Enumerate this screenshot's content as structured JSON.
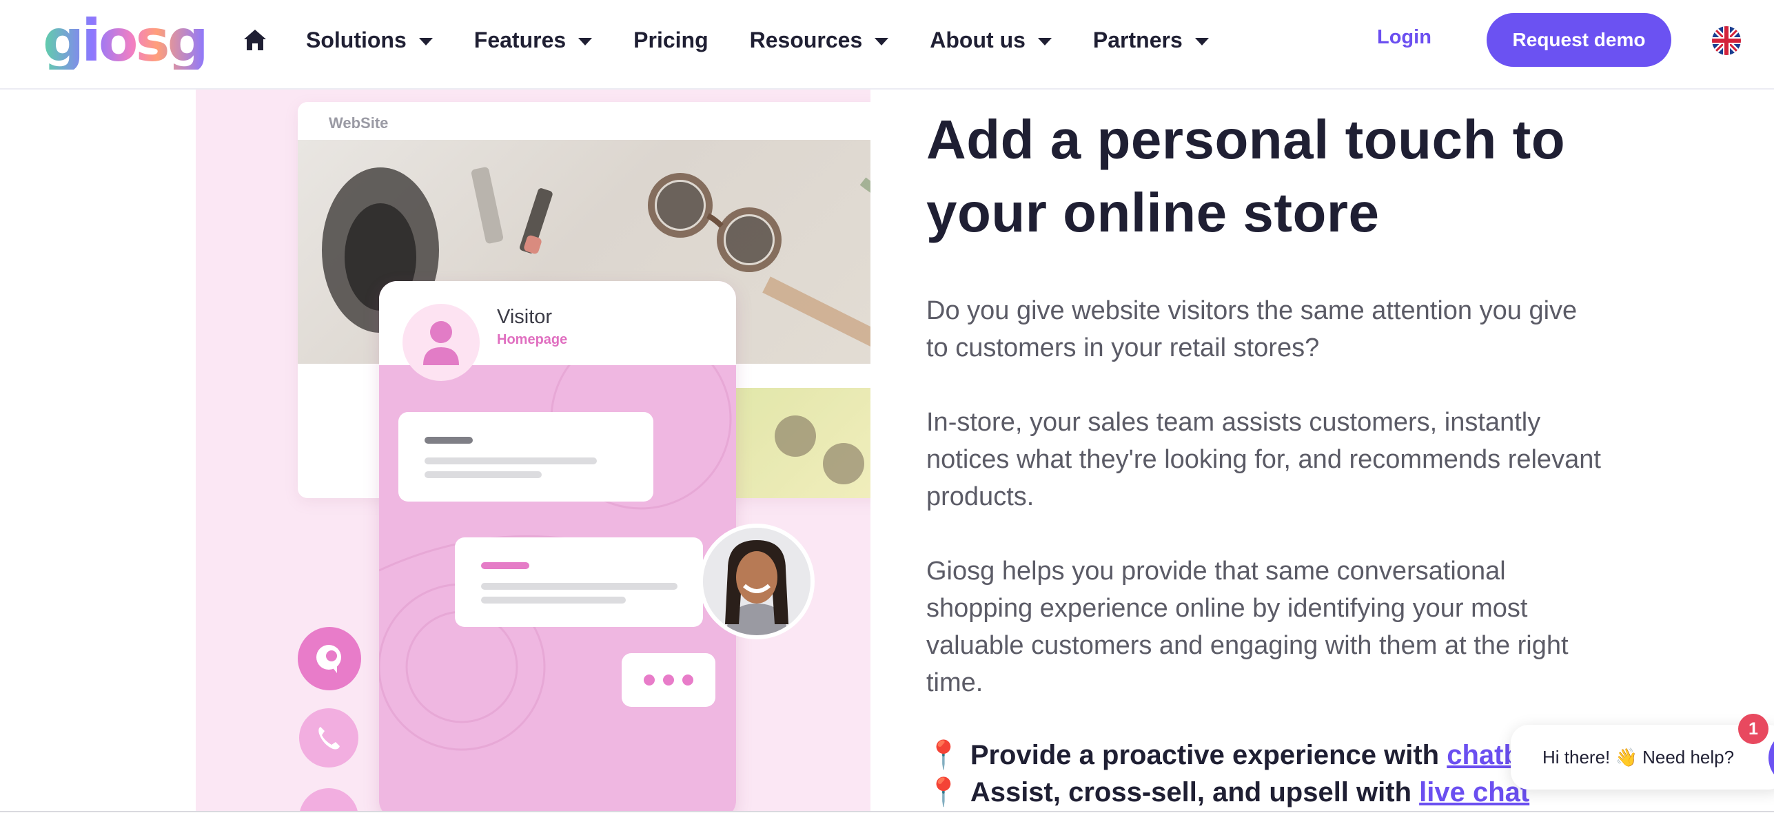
{
  "brand": {
    "logo_text": "giosg"
  },
  "nav": {
    "home_icon": "home-icon",
    "items": [
      {
        "label": "Solutions",
        "dropdown": true
      },
      {
        "label": "Features",
        "dropdown": true
      },
      {
        "label": "Pricing",
        "dropdown": false
      },
      {
        "label": "Resources",
        "dropdown": true
      },
      {
        "label": "About us",
        "dropdown": true
      },
      {
        "label": "Partners",
        "dropdown": true
      }
    ],
    "login_label": "Login",
    "demo_label": "Request demo",
    "language_icon": "uk-flag-icon"
  },
  "illustration": {
    "site_label": "WebSite",
    "visitor_name": "Visitor",
    "visitor_page": "Homepage"
  },
  "content": {
    "headline": "Add a personal touch to your online store",
    "paragraphs": [
      "Do you give website visitors the same attention you give to customers in your retail stores?",
      "In-store, your sales team assists customers, instantly notices what they're looking for, and recommends relevant products.",
      "Giosg helps you provide that same conversational shopping experience online by identifying your most valuable customers and engaging with them at the right time."
    ],
    "bullets": [
      {
        "pin": "📍",
        "text": "Provide a proactive experience with ",
        "link": "chatbo"
      },
      {
        "pin": "📍",
        "text": "Assist, cross-sell, and upsell with ",
        "link": "live chat"
      }
    ]
  },
  "chat_widget": {
    "message": "Hi there! 👋 Need help?",
    "badge_count": "1"
  },
  "colors": {
    "accent": "#6b52f2",
    "link": "#6b4ff0",
    "pink": "#efb7e1",
    "heading": "#1f1f33",
    "body_text": "#5b5b66",
    "badge": "#e8495f"
  }
}
